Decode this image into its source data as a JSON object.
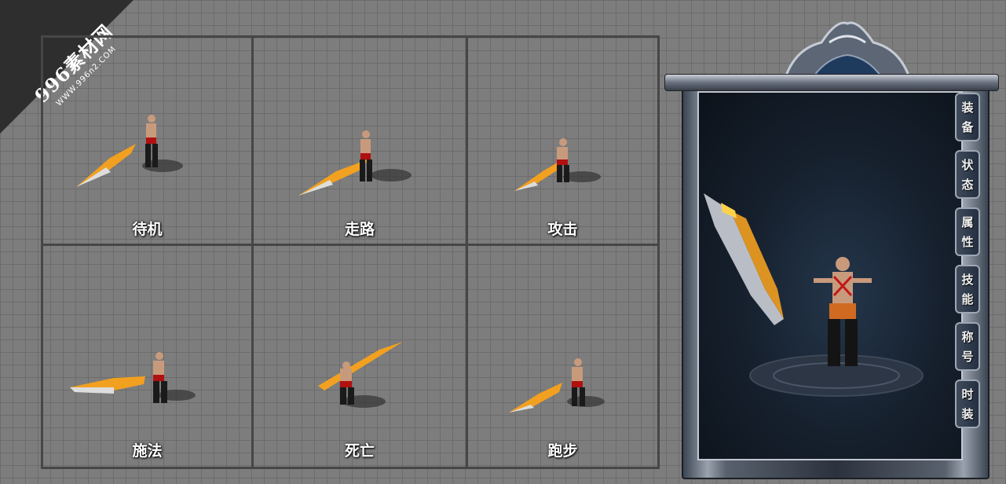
{
  "watermark": {
    "brand": "996素材网",
    "url": "WWW.996n2.COM"
  },
  "animations": [
    {
      "label": "待机"
    },
    {
      "label": "走路"
    },
    {
      "label": "攻击"
    },
    {
      "label": "施法"
    },
    {
      "label": "死亡"
    },
    {
      "label": "跑步"
    }
  ],
  "panel": {
    "tabs": [
      {
        "label": "装备"
      },
      {
        "label": "状态"
      },
      {
        "label": "属性"
      },
      {
        "label": "技能"
      },
      {
        "label": "称号"
      },
      {
        "label": "时装"
      }
    ]
  },
  "colors": {
    "background": "#7d7d7d",
    "grid_line": "#464646",
    "panel_screen": "#16202d",
    "flame": "#f2a020"
  }
}
